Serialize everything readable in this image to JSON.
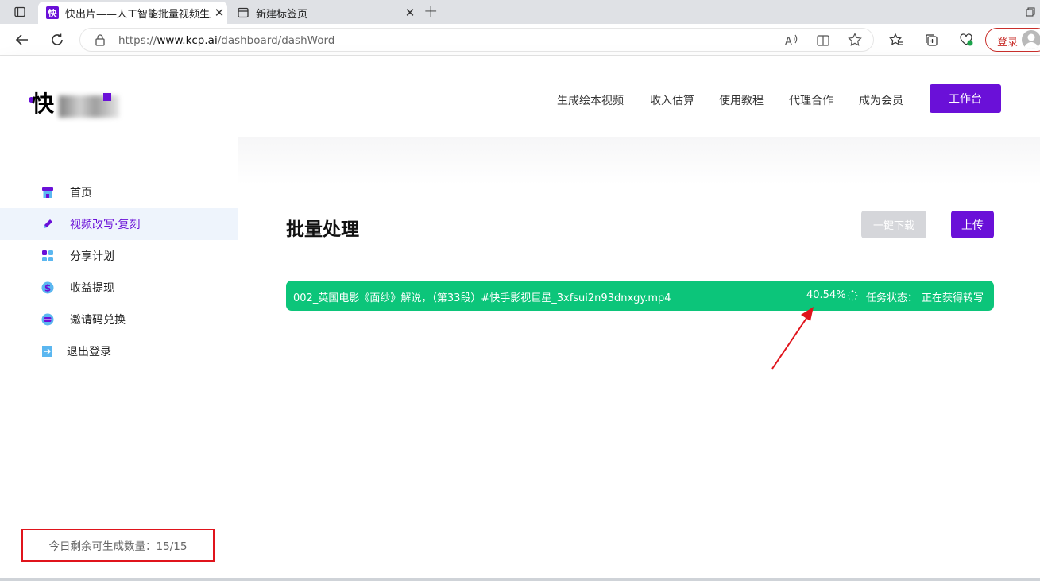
{
  "browser": {
    "tabs": [
      {
        "title": "快出片——人工智能批量视频生成",
        "favicon": "kuai-logo-icon"
      },
      {
        "title": "新建标签页",
        "favicon": "newtab-icon"
      }
    ],
    "url_prefix": "https://",
    "url_host": "www.kcp.ai",
    "url_path": "/dashboard/dashWord",
    "login_label": "登录"
  },
  "header": {
    "logo_char": "快",
    "nav": [
      "生成绘本视频",
      "收入估算",
      "使用教程",
      "代理合作",
      "成为会员"
    ],
    "workspace_label": "工作台"
  },
  "sidebar": {
    "items": [
      {
        "label": "首页",
        "icon": "shop-icon"
      },
      {
        "label": "视频改写·复刻",
        "icon": "pen-icon"
      },
      {
        "label": "分享计划",
        "icon": "grid-icon"
      },
      {
        "label": "收益提现",
        "icon": "dollar-icon"
      },
      {
        "label": "邀请码兑换",
        "icon": "card-icon"
      },
      {
        "label": "退出登录",
        "icon": "logout-icon"
      }
    ],
    "quota_text": "今日剩余可生成数量：15/15"
  },
  "main": {
    "title": "批量处理",
    "download_all_label": "一键下载",
    "upload_label": "上传",
    "task": {
      "filename": "002_英国电影《面纱》解说，（第33段）#快手影视巨星_3xfsui2n93dnxgy.mp4",
      "progress": "40.54%",
      "status_label": "任务状态：",
      "status_value": "正在获得转写"
    }
  },
  "colors": {
    "brand": "#6a10d8",
    "task_green": "#0cc57a",
    "annotation_red": "#e0141c"
  }
}
